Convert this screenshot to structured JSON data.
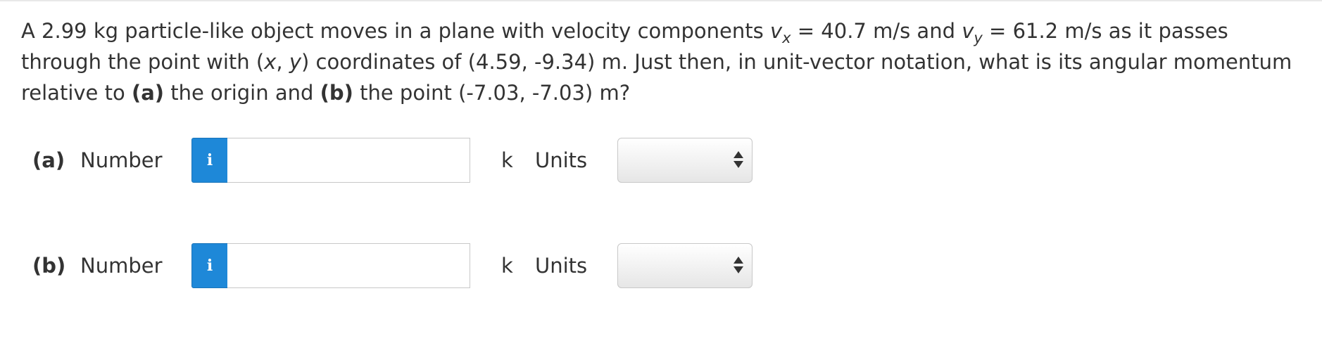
{
  "question": {
    "t1": "A 2.99 kg particle-like object moves in a plane with velocity components ",
    "v1": "v",
    "sub1": "x",
    "t2": " = 40.7 m/s and ",
    "v2": "v",
    "sub2": "y",
    "t3": " = 61.2 m/s as it passes through the point with (",
    "x": "x",
    "comma": ", ",
    "y": "y",
    "t4": ") coordinates of (4.59, -9.34) m. Just then, in unit-vector notation, what is its angular momentum relative to ",
    "a": "(a)",
    "t5": " the origin and ",
    "b": "(b)",
    "t6": " the point (-7.03, -7.03) m?"
  },
  "parts": [
    {
      "label": "(a)",
      "number_label": "Number",
      "info_icon": "i",
      "value": "",
      "unit_vector": "k",
      "units_label": "Units",
      "units_value": ""
    },
    {
      "label": "(b)",
      "number_label": "Number",
      "info_icon": "i",
      "value": "",
      "unit_vector": "k",
      "units_label": "Units",
      "units_value": ""
    }
  ],
  "colors": {
    "info_button": "#1e88d8",
    "text": "#333333"
  },
  "icons": {
    "info": "info-icon",
    "select_arrows": "up-down-arrows-icon"
  }
}
